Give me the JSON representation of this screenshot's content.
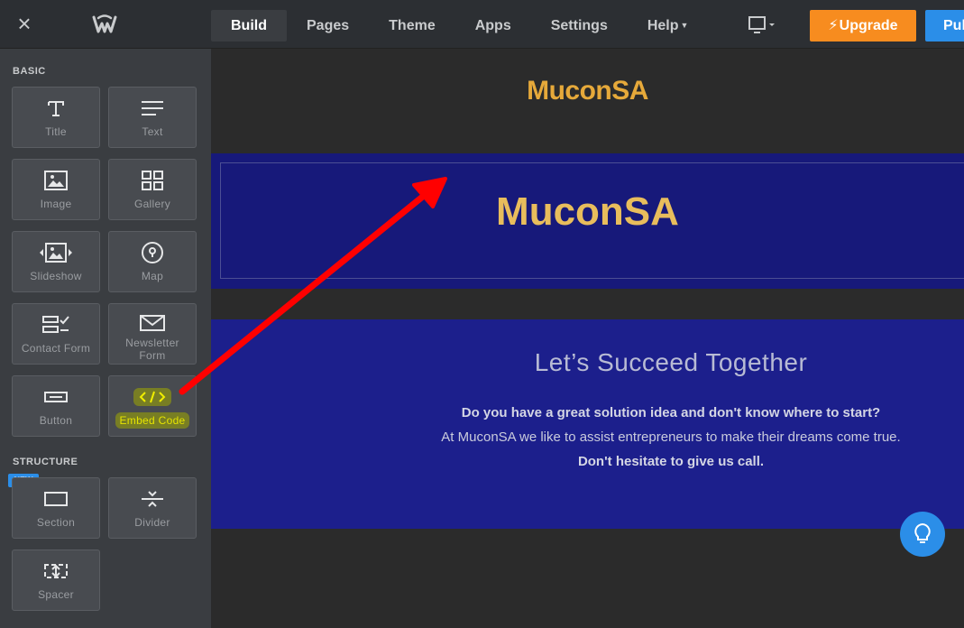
{
  "topbar": {
    "close_icon": "close-icon",
    "logo_icon": "weebly-logo-icon",
    "nav": [
      {
        "label": "Build",
        "active": true
      },
      {
        "label": "Pages"
      },
      {
        "label": "Theme"
      },
      {
        "label": "Apps"
      },
      {
        "label": "Settings"
      },
      {
        "label": "Help",
        "has_caret": true
      }
    ],
    "device_icon": "monitor-icon",
    "upgrade_label": "Upgrade",
    "publish_label": "Publish",
    "colors": {
      "upgrade": "#f78c1f",
      "publish": "#2b8ee8"
    }
  },
  "sidebar": {
    "basic_label": "BASIC",
    "structure_label": "STRUCTURE",
    "new_badge": "NEW",
    "basic_items": [
      {
        "label": "Title",
        "icon": "title-icon"
      },
      {
        "label": "Text",
        "icon": "text-lines-icon"
      },
      {
        "label": "Image",
        "icon": "image-icon"
      },
      {
        "label": "Gallery",
        "icon": "gallery-icon"
      },
      {
        "label": "Slideshow",
        "icon": "slideshow-icon"
      },
      {
        "label": "Map",
        "icon": "map-pin-icon"
      },
      {
        "label": "Contact Form",
        "icon": "contact-form-icon"
      },
      {
        "label": "Newsletter Form",
        "icon": "envelope-icon"
      },
      {
        "label": "Button",
        "icon": "button-icon"
      },
      {
        "label": "Embed Code",
        "icon": "code-icon",
        "highlighted": true
      }
    ],
    "structure_items": [
      {
        "label": "Section",
        "icon": "section-icon"
      },
      {
        "label": "Divider",
        "icon": "divider-icon"
      },
      {
        "label": "Spacer",
        "icon": "spacer-icon"
      }
    ]
  },
  "canvas": {
    "site_title": "MuconSA",
    "banner_title": "MuconSA",
    "heading": "Let’s Succeed Together",
    "line1": "Do you have a great solution idea and don't know where to start?",
    "line2": "At MuconSA we like to assist entrepreneurs to make their dreams come true.",
    "line3": "Don't hesitate to give us call.",
    "colors": {
      "title": "#e6a93a",
      "banner": "#17197a",
      "section": "#1c1f8c"
    },
    "help_icon": "lightbulb-icon"
  },
  "annotation": {
    "arrow_color": "#ff0000"
  }
}
